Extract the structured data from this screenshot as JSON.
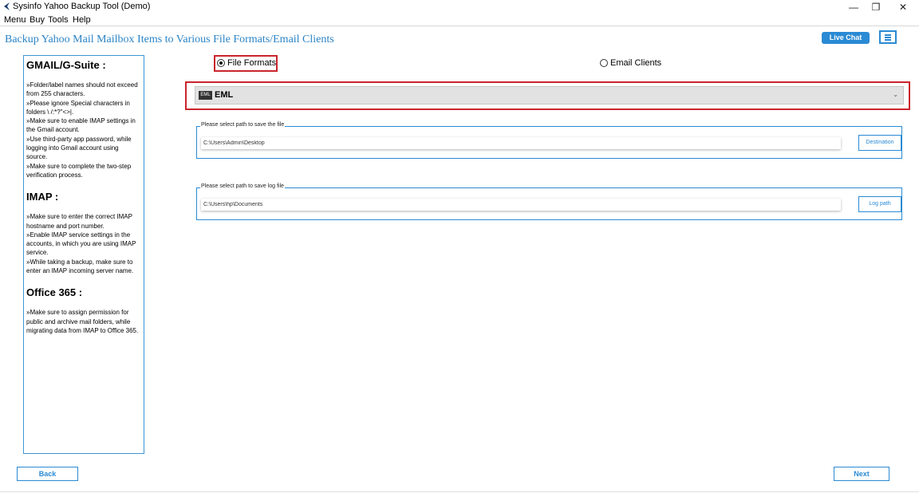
{
  "window": {
    "title": "Sysinfo Yahoo Backup Tool (Demo)",
    "controls": {
      "minimize": "—",
      "restore": "❐",
      "close": "✕"
    }
  },
  "menubar": {
    "items": [
      "Menu",
      "Buy",
      "Tools",
      "Help"
    ]
  },
  "header": {
    "heading": "Backup Yahoo Mail Mailbox Items to Various File Formats/Email Clients",
    "live_chat": "Live Chat",
    "menu_icon": "hamburger-icon"
  },
  "info_panel": {
    "sections": [
      {
        "heading": "GMAIL/G-Suite :",
        "text": "»Folder/label names should not exceed from 255 characters.\n»Please ignore Special characters in folders \\ /:*?\"<>|.\n»Make sure to enable IMAP settings in the Gmail account.\n»Use third-party app password, while logging into Gmail account using source.\n»Make sure to complete the two-step verification process."
      },
      {
        "heading": "IMAP :",
        "text": "»Make sure to enter the correct IMAP hostname and port number.\n»Enable IMAP service settings in the accounts, in which you are using IMAP service.\n»While taking a backup, make sure to enter an IMAP incoming server name."
      },
      {
        "heading": "Office 365 :",
        "text": "»Make sure to assign permission for public and archive mail folders, while migrating data from IMAP to Office 365."
      }
    ]
  },
  "options": {
    "file_formats": {
      "label": "File Formats",
      "selected": true
    },
    "email_clients": {
      "label": "Email Clients",
      "selected": false
    }
  },
  "format_select": {
    "badge": "EML",
    "value": "EML",
    "chevron": "⌄"
  },
  "save_path": {
    "legend": "Please select path to save the file",
    "value": "C:\\Users\\Admin\\Desktop",
    "button": "Destination"
  },
  "log_path": {
    "legend": "Please select path to save log file",
    "value": "C:\\Users\\hp\\Documents",
    "button": "Log path"
  },
  "footer": {
    "back": "Back",
    "next": "Next"
  },
  "colors": {
    "accent": "#2a8ad4",
    "highlight": "#c9252c",
    "heading": "#2b84c6"
  }
}
